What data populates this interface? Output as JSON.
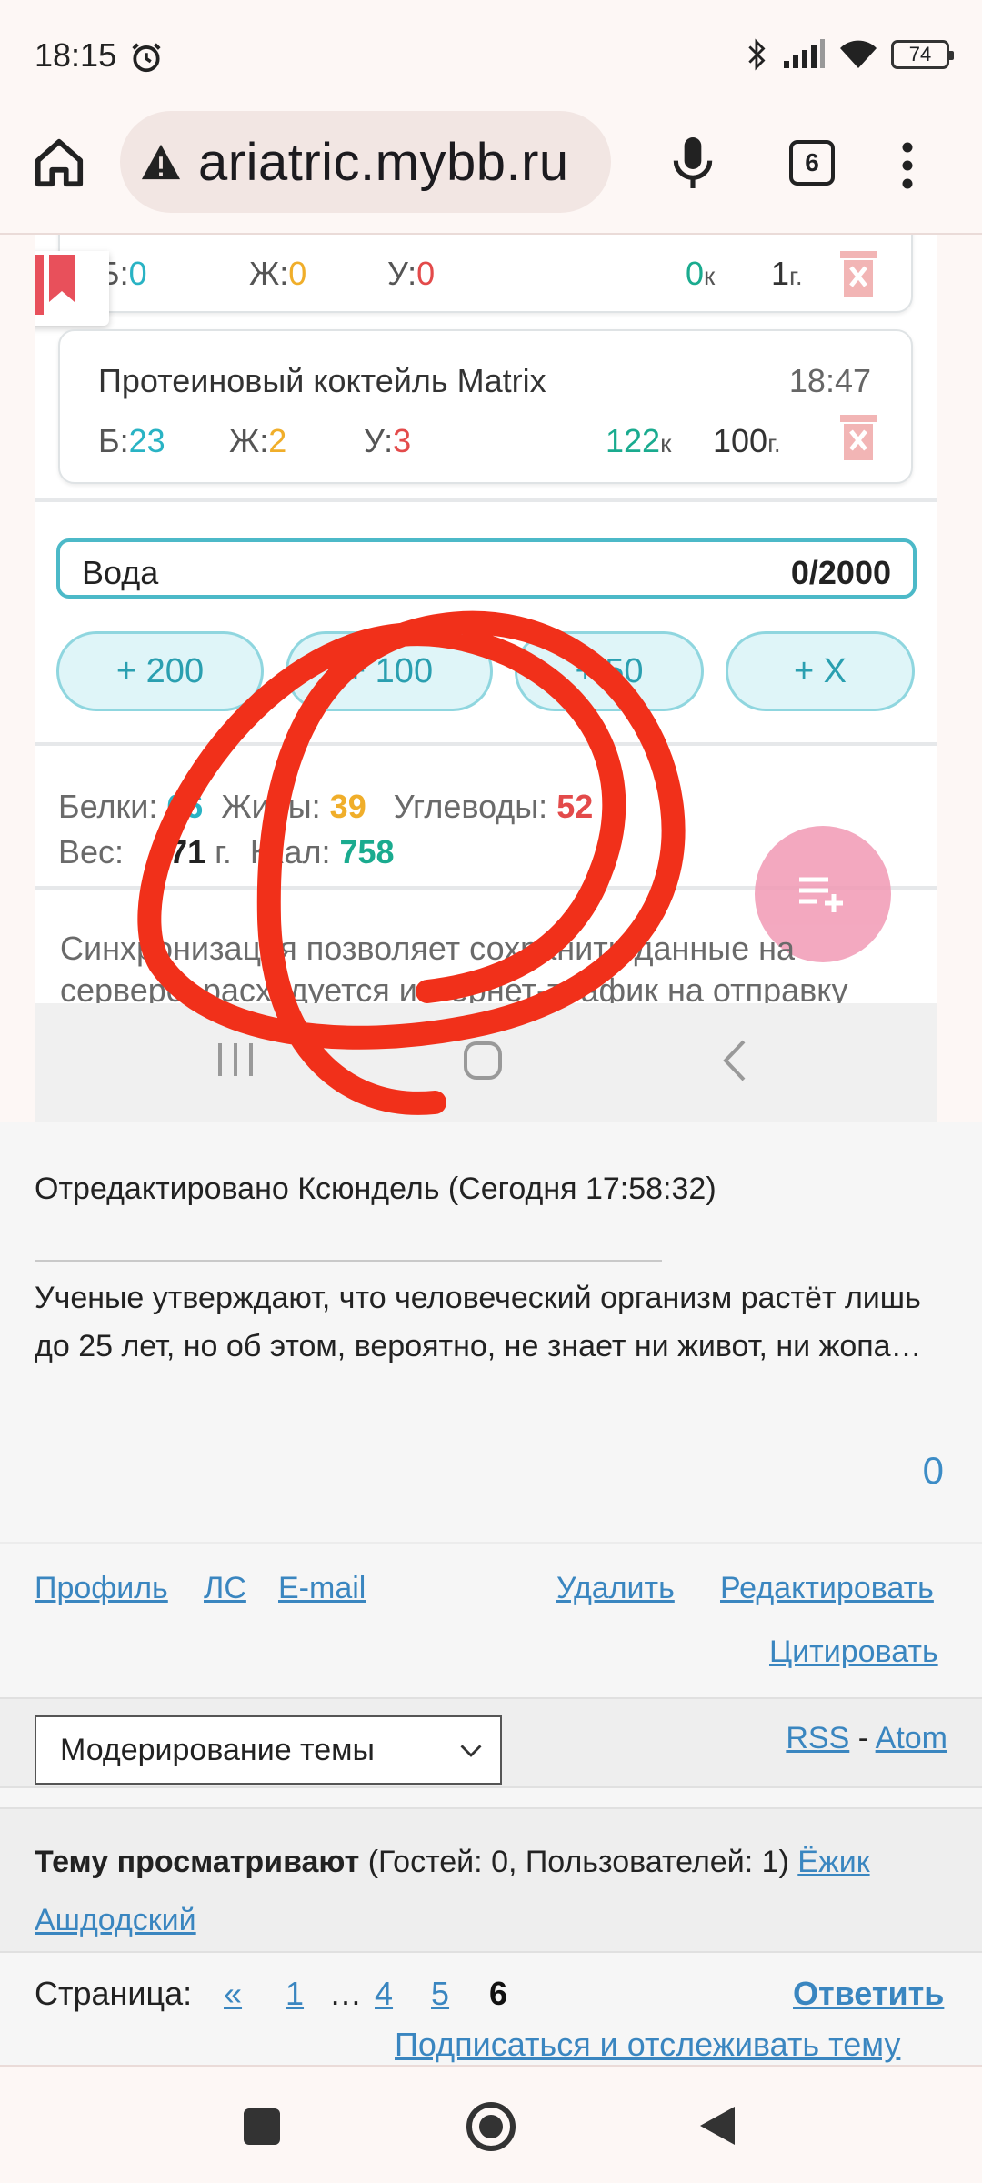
{
  "status_bar": {
    "time": "18:15",
    "battery": "74"
  },
  "browser": {
    "url": "ariatric.mybb.ru",
    "tab_count": "6"
  },
  "diary": {
    "macro_labels": {
      "protein": "Б:",
      "fat": "Ж:",
      "carbs": "У:"
    },
    "entries": [
      {
        "name": "",
        "time": "",
        "protein": "0",
        "fat": "0",
        "carbs": "0",
        "kcal": "0",
        "kcal_unit": "к",
        "weight": "1",
        "weight_unit": "г."
      },
      {
        "name": "Протеиновый коктейль Matrix",
        "time": "18:47",
        "protein": "23",
        "fat": "2",
        "carbs": "3",
        "kcal": "122",
        "kcal_unit": "к",
        "weight": "100",
        "weight_unit": "г."
      }
    ],
    "water": {
      "label": "Вода",
      "value": "0/2000"
    },
    "water_buttons": [
      "+ 200",
      "+ 100",
      "+ 50",
      "+ X"
    ],
    "totals": {
      "protein_label": "Белки:",
      "protein": "66",
      "fat_label": "Жиры:",
      "fat": "39",
      "carbs_label": "Углеводы:",
      "carbs": "52",
      "weight_label": "Вес:",
      "weight": "471",
      "weight_unit": "г.",
      "kcal_label": "Ккал:",
      "kcal": "758"
    },
    "sync_text": "Синхронизация позволяет сохранить данные на сервере, расходуется интернет-трафик на отправку"
  },
  "post": {
    "edited": "Отредактировано Ксюндель (Сегодня 17:58:32)",
    "signature": "Ученые утверждают, что человеческий организм растёт лишь до 25 лет, но об этом, вероятно, не знает ни живот, ни жопа…",
    "likes": "0",
    "links": {
      "profile": "Профиль",
      "pm": "ЛС",
      "email": "E-mail",
      "delete": "Удалить",
      "edit": "Редактировать",
      "quote": "Цитировать"
    }
  },
  "moderation": {
    "select": "Модерирование темы",
    "rss": "RSS",
    "dash": "-",
    "atom": "Atom"
  },
  "viewers": {
    "label": "Тему просматривают",
    "counts": "(Гостей: 0, Пользователей: 1)",
    "user": "Ёжик Ашдодский"
  },
  "pager": {
    "label": "Страница:",
    "prev": "«",
    "pages": [
      "1",
      "…",
      "4",
      "5"
    ],
    "current": "6",
    "reply": "Ответить",
    "subscribe": "Подписаться и отслеживать тему"
  },
  "colors": {
    "accent_link": "#3a86c0",
    "protein": "#29b3c4",
    "fat": "#f0ae2a",
    "carbs": "#e34a4a",
    "kcal": "#1aab8f",
    "scribble": "#f1301a"
  }
}
